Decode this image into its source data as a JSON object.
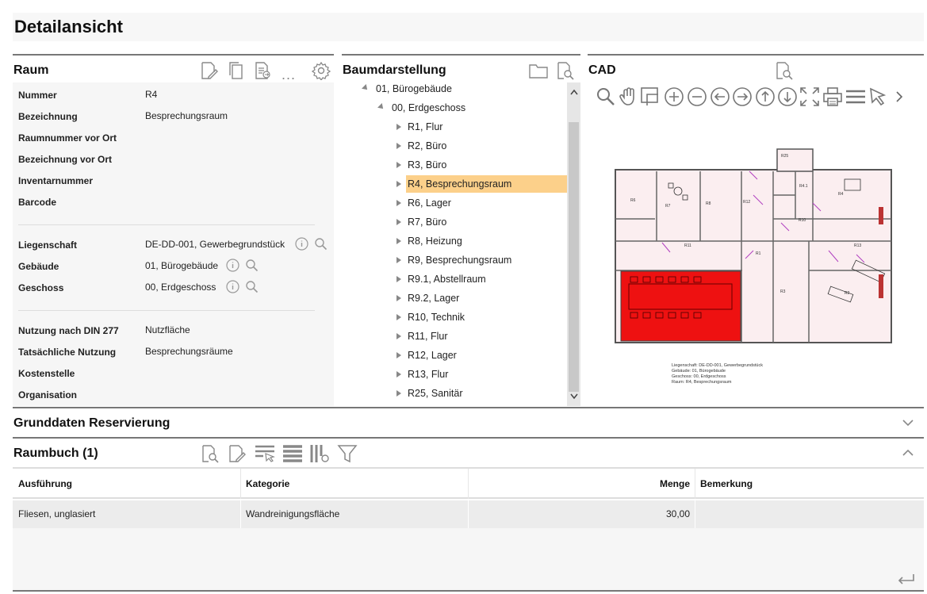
{
  "page": {
    "title": "Detailansicht"
  },
  "raum": {
    "title": "Raum",
    "fields": [
      {
        "label": "Nummer",
        "value": "R4"
      },
      {
        "label": "Bezeichnung",
        "value": "Besprechungsraum"
      },
      {
        "label": "Raumnummer vor Ort",
        "value": ""
      },
      {
        "label": "Bezeichnung vor Ort",
        "value": ""
      },
      {
        "label": "Inventarnummer",
        "value": ""
      },
      {
        "label": "Barcode",
        "value": ""
      },
      {
        "label": "Liegenschaft",
        "value": "DE-DD-001, Gewerbegrundstück"
      },
      {
        "label": "Gebäude",
        "value": "01, Bürogebäude"
      },
      {
        "label": "Geschoss",
        "value": "00, Erdgeschoss"
      },
      {
        "label": "Nutzung nach DIN 277",
        "value": "Nutzfläche"
      },
      {
        "label": "Tatsächliche Nutzung",
        "value": "Besprechungsräume"
      },
      {
        "label": "Kostenstelle",
        "value": ""
      },
      {
        "label": "Organisation",
        "value": ""
      }
    ],
    "more_label": "..."
  },
  "tree": {
    "title": "Baumdarstellung",
    "building": "01, Bürogebäude",
    "floor": "00, Erdgeschoss",
    "rooms": [
      "R1, Flur",
      "R2, Büro",
      "R3, Büro",
      "R4, Besprechungsraum",
      "R6, Lager",
      "R7, Büro",
      "R8, Heizung",
      "R9, Besprechungsraum",
      "R9.1, Abstellraum",
      "R9.2, Lager",
      "R10, Technik",
      "R11, Flur",
      "R12, Lager",
      "R13, Flur",
      "R25, Sanitär"
    ],
    "selected_index": 3
  },
  "cad": {
    "title": "CAD",
    "tools": [
      "zoom-icon",
      "hand-icon",
      "select-area-icon",
      "zoom-in-icon",
      "zoom-out-icon",
      "arrow-left-icon",
      "arrow-right-icon",
      "arrow-up-icon",
      "arrow-down-icon",
      "fit-icon",
      "print-icon",
      "menu-icon",
      "pointer-icon",
      "more-icon"
    ],
    "legend": [
      "Liegenschaft: DE-DD-001, Gewerbegrundstück",
      "Gebäude: 01, Bürogebäude",
      "Geschoss: 00, Erdgeschoss",
      "Raum: R4, Besprechungsraum"
    ],
    "room_labels": [
      "R25",
      "R6",
      "R7",
      "R8",
      "R12",
      "R4",
      "R11",
      "R13",
      "R1",
      "R10",
      "R3",
      "R2",
      "R4.1"
    ]
  },
  "grunddaten": {
    "title": "Grunddaten Reservierung"
  },
  "raumbuch": {
    "title": "Raumbuch (1)",
    "columns": [
      "Ausführung",
      "Kategorie",
      "Menge",
      "Bemerkung"
    ],
    "rows": [
      {
        "ausfuehrung": "Fliesen, unglasiert",
        "kategorie": "Wandreinigungsfläche",
        "menge": "30,00",
        "bemerkung": ""
      }
    ]
  },
  "colors": {
    "selected": "#fcd08a",
    "highlight_room": "#ee1111",
    "plan_room": "#fbeef0"
  }
}
